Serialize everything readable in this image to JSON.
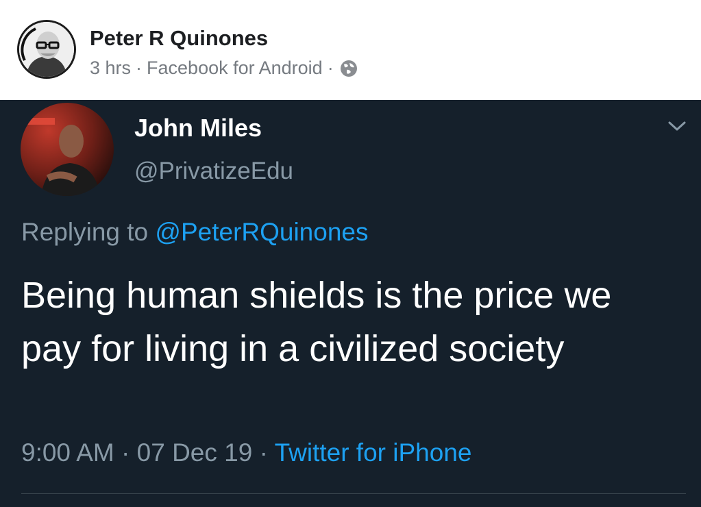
{
  "facebook_post": {
    "author_name": "Peter R Quinones",
    "time": "3 hrs",
    "source": "Facebook for Android",
    "separator": "·",
    "privacy_icon": "globe-icon"
  },
  "tweet": {
    "display_name": "John Miles",
    "handle": "@PrivatizeEdu",
    "replying_prefix": "Replying to",
    "replying_to": "@PeterRQuinones",
    "text": "Being human shields is the price we pay for living in a civilized society",
    "time": "9:00 AM",
    "date": "07 Dec 19",
    "separator": "·",
    "client": "Twitter for iPhone",
    "menu_icon": "chevron-down-icon"
  },
  "colors": {
    "tweet_background": "#15202b",
    "link_blue": "#1da1f2",
    "secondary_text": "#8899a6"
  }
}
